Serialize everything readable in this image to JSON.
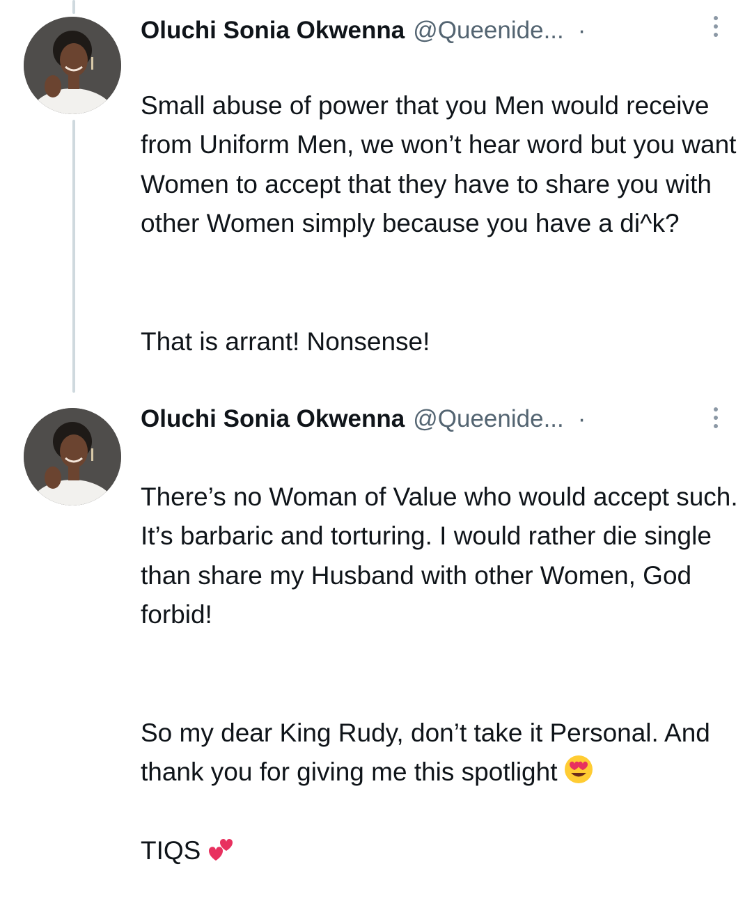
{
  "tweets": [
    {
      "author": {
        "display_name": "Oluchi Sonia Okwenna",
        "handle": "@Queenide...",
        "separator": "·"
      },
      "paragraphs": [
        "Small abuse of power that you Men would receive from Uniform Men, we won’t hear word but you want Women to accept that they have to share you with other Women simply because you have a di^k?",
        "That is arrant! Nonsense!"
      ]
    },
    {
      "author": {
        "display_name": "Oluchi Sonia Okwenna",
        "handle": "@Queenide...",
        "separator": "·"
      },
      "paragraphs": [
        "There’s no Woman of Value who would accept such. It’s barbaric and torturing. I would rather die single than share my Husband with other Women, God forbid!",
        "So my dear King Rudy, don’t take it Personal. And thank you for giving me this spotlight"
      ],
      "sign_off": "TIQS",
      "emojis": [
        "heart-eyes-emoji",
        "two-hearts-emoji"
      ]
    }
  ],
  "icons": {
    "more": "more-vertical-icon"
  },
  "colors": {
    "text_primary": "#0f1419",
    "text_secondary": "#536471",
    "thread_line": "#cfd9de",
    "emoji_face": "#ffcc33",
    "heart": "#e8315f"
  }
}
